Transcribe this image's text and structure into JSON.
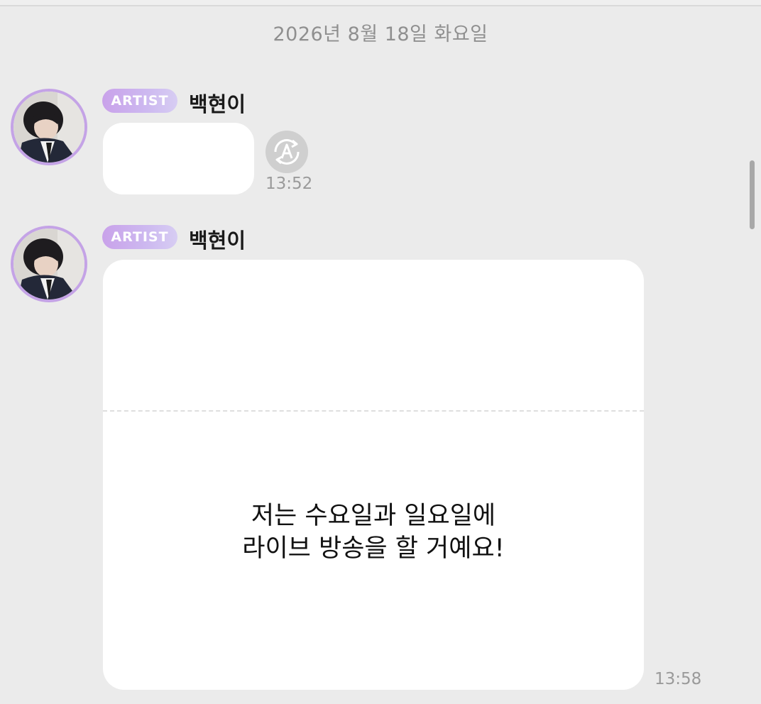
{
  "date_header": "2026년 8월 18일 화요일",
  "messages": [
    {
      "badge": "ARTIST",
      "sender": "백현이",
      "time": "13:52",
      "translate_icon": "auto-translate-icon"
    },
    {
      "badge": "ARTIST",
      "sender": "백현이",
      "text_line1": "저는 수요일과 일요일에",
      "text_line2": "라이브 방송을 할 거예요!",
      "time": "13:58"
    }
  ],
  "colors": {
    "background": "#ebebeb",
    "bubble": "#ffffff",
    "badge_start": "#c9a2ea",
    "avatar_ring": "#c4a3e6",
    "timestamp": "#9a9a9a"
  }
}
